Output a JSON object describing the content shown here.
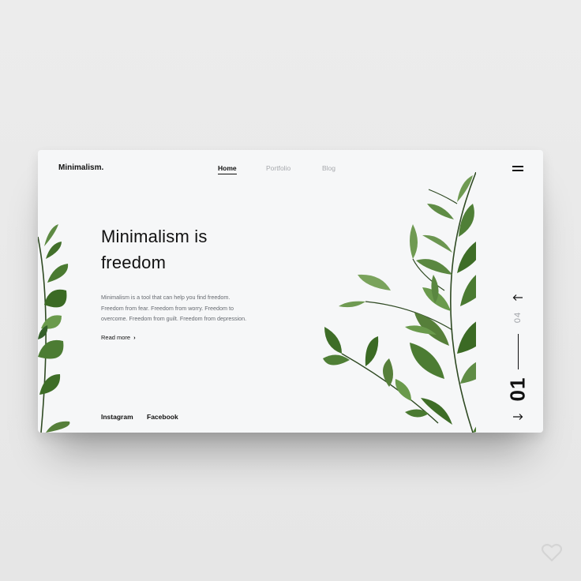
{
  "header": {
    "logo": "Minimalism.",
    "nav": [
      {
        "label": "Home",
        "active": true
      },
      {
        "label": "Portfolio",
        "active": false
      },
      {
        "label": "Blog",
        "active": false
      }
    ],
    "menu_icon": "hamburger-menu-icon"
  },
  "hero": {
    "title_line1": "Minimalism is",
    "title_line2": "freedom",
    "description_lines": [
      "Minimalism is a tool that can help you find freedom.",
      "Freedom from fear. Freedom from worry. Freedom to",
      "overcome. Freedom from guilt. Freedom from depression."
    ],
    "read_more": "Read more"
  },
  "social": {
    "instagram": "Instagram",
    "facebook": "Facebook"
  },
  "slider": {
    "current": "01",
    "total": "04",
    "prev_icon": "arrow-left-icon",
    "next_icon": "arrow-right-icon"
  },
  "colors": {
    "background": "#e9e9e9",
    "card": "#f6f7f8",
    "text": "#111111",
    "muted": "#a7a9ad",
    "leaf_dark": "#3e6d27",
    "leaf_light": "#6f9a52",
    "stem": "#2f4a23"
  },
  "watermark_icon": "heart-icon"
}
